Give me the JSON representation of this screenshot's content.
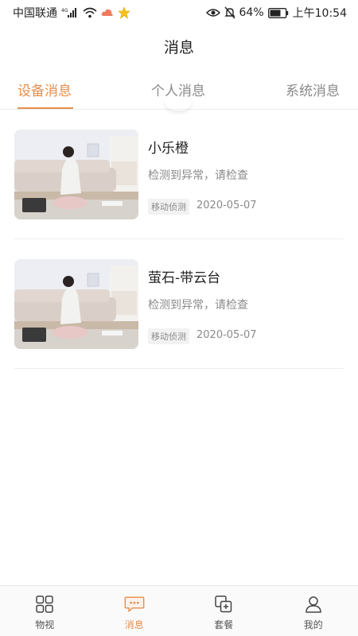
{
  "status_bar": {
    "carrier": "中国联通",
    "network": "4G",
    "battery": "64%",
    "time": "上午10:54"
  },
  "header": {
    "title": "消息"
  },
  "tabs": [
    {
      "label": "设备消息",
      "active": true
    },
    {
      "label": "个人消息",
      "active": false
    },
    {
      "label": "系统消息",
      "active": false
    }
  ],
  "messages": [
    {
      "title": "小乐橙",
      "desc": "检测到异常，请检查",
      "tag": "移动侦测",
      "date": "2020-05-07"
    },
    {
      "title": "萤石-带云台",
      "desc": "检测到异常，请检查",
      "tag": "移动侦测",
      "date": "2020-05-07"
    }
  ],
  "bottom_nav": [
    {
      "label": "物视",
      "icon": "grid-icon",
      "active": false
    },
    {
      "label": "消息",
      "icon": "message-icon",
      "active": true
    },
    {
      "label": "套餐",
      "icon": "package-icon",
      "active": false
    },
    {
      "label": "我的",
      "icon": "person-icon",
      "active": false
    }
  ],
  "colors": {
    "accent": "#e58e4c",
    "muted": "#8a8a8a"
  }
}
